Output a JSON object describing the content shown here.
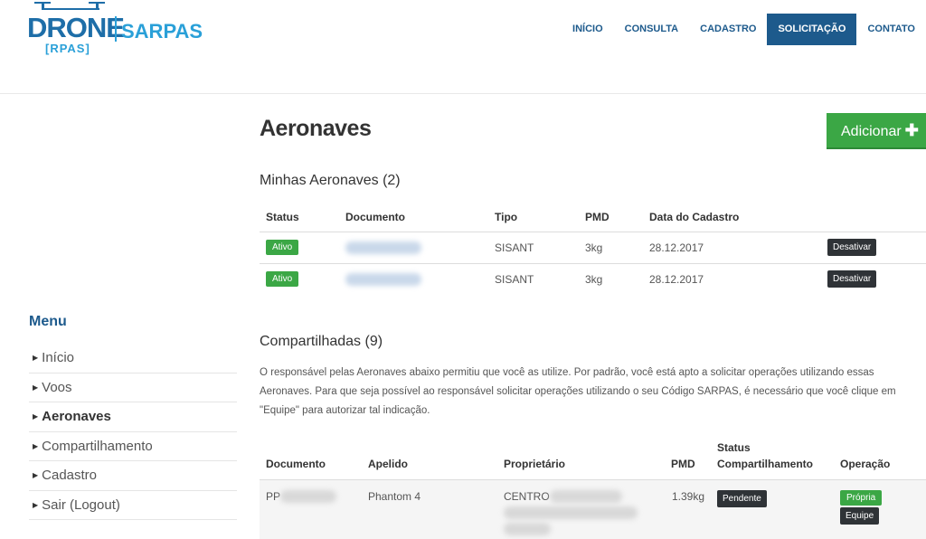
{
  "logo": {
    "drone": "DRONE",
    "sarpas": "SARPAS",
    "rpas": "[RPAS]"
  },
  "nav": [
    "INÍCIO",
    "CONSULTA",
    "CADASTRO",
    "SOLICITAÇÃO",
    "CONTATO"
  ],
  "nav_active": "SOLICITAÇÃO",
  "sidebar": {
    "title": "Menu",
    "items": [
      "Início",
      "Voos",
      "Aeronaves",
      "Compartilhamento",
      "Cadastro",
      "Sair (Logout)"
    ],
    "active": "Aeronaves"
  },
  "main": {
    "title": "Aeronaves",
    "add_label": "Adicionar",
    "my_section": "Minhas Aeronaves (2)",
    "my_headers": [
      "Status",
      "Documento",
      "Tipo",
      "PMD",
      "Data do Cadastro"
    ],
    "my_rows": [
      {
        "status": "Ativo",
        "tipo": "SISANT",
        "pmd": "3kg",
        "data": "28.12.2017",
        "action": "Desativar"
      },
      {
        "status": "Ativo",
        "tipo": "SISANT",
        "pmd": "3kg",
        "data": "28.12.2017",
        "action": "Desativar"
      }
    ],
    "shared_section": "Compartilhadas (9)",
    "shared_notice": "O responsável pelas Aeronaves abaixo permitiu que você as utilize. Por padrão, você está apto a solicitar operações utilizando essas Aeronaves. Para que seja possível ao responsável solicitar operações utilizando o seu Código SARPAS, é necessário que você clique em \"Equipe\" para autorizar tal indicação.",
    "shared_headers": [
      "Documento",
      "Apelido",
      "Proprietário",
      "PMD",
      "Status Compartilhamento",
      "Operação"
    ],
    "shared_rows": [
      {
        "documento": "PP",
        "apelido": "Phantom 4",
        "proprietario": "CENTRO",
        "pmd": "1.39kg",
        "status": "Pendente",
        "op1": "Própria",
        "op2": "Equipe"
      }
    ]
  },
  "colors": {
    "brand": "#1d5a8c",
    "success": "#3ba745",
    "dark": "#2f3337"
  }
}
